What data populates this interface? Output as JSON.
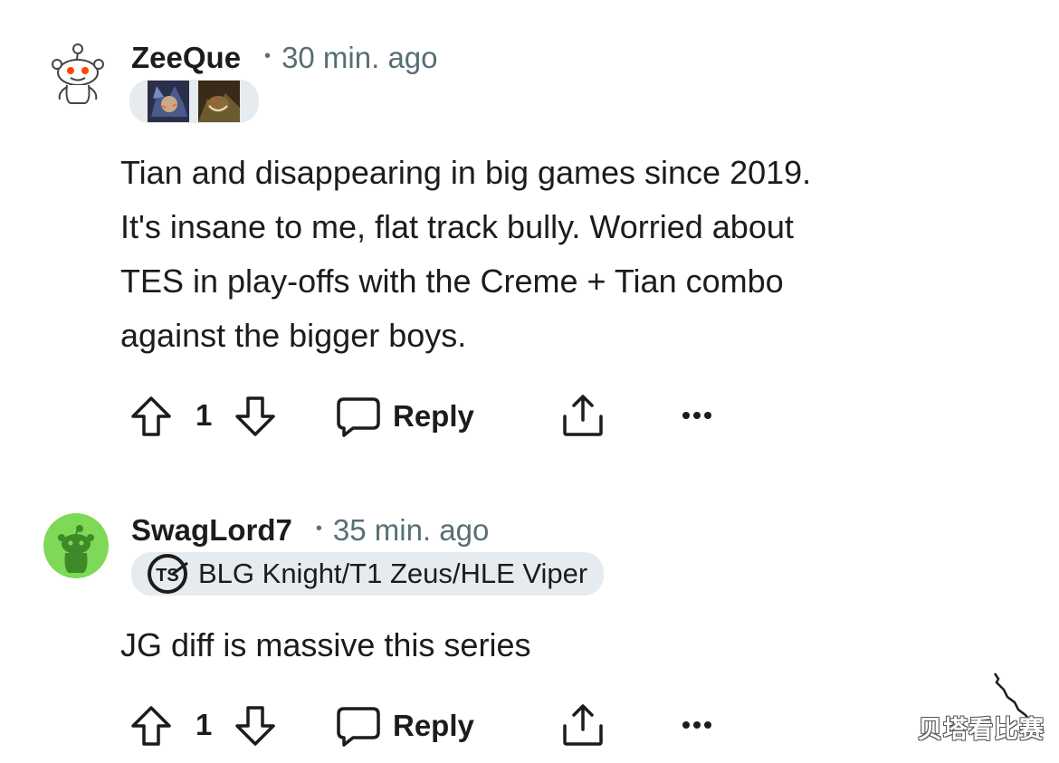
{
  "comments": [
    {
      "username": "ZeeQue",
      "time": "30 min. ago",
      "separator": "•",
      "avatar_icon": "reddit-snoo-icon",
      "flair_icons": [
        "champion-portrait-icon",
        "champion-portrait-icon"
      ],
      "body_lines": [
        "Tian and disappearing in big games since 2019.",
        "It's insane to me, flat track bully. Worried about",
        "TES in play-offs with the Creme + Tian combo",
        "against the bigger boys."
      ],
      "votes": "1",
      "reply_label": "Reply"
    },
    {
      "username": "SwagLord7",
      "time": "35 min. ago",
      "separator": "•",
      "avatar_icon": "reddit-snoo-icon",
      "flair_icon": "tsm-logo-icon",
      "flair_text": "BLG Knight/T1 Zeus/HLE Viper",
      "body_lines": [
        "JG diff is massive this series"
      ],
      "votes": "1",
      "reply_label": "Reply"
    }
  ],
  "watermark": "贝塔看比赛",
  "colors": {
    "text": "#1c1c1c",
    "meta": "#576f76",
    "flair_bg": "#e5ebee",
    "avatar_green": "#7ed957"
  }
}
